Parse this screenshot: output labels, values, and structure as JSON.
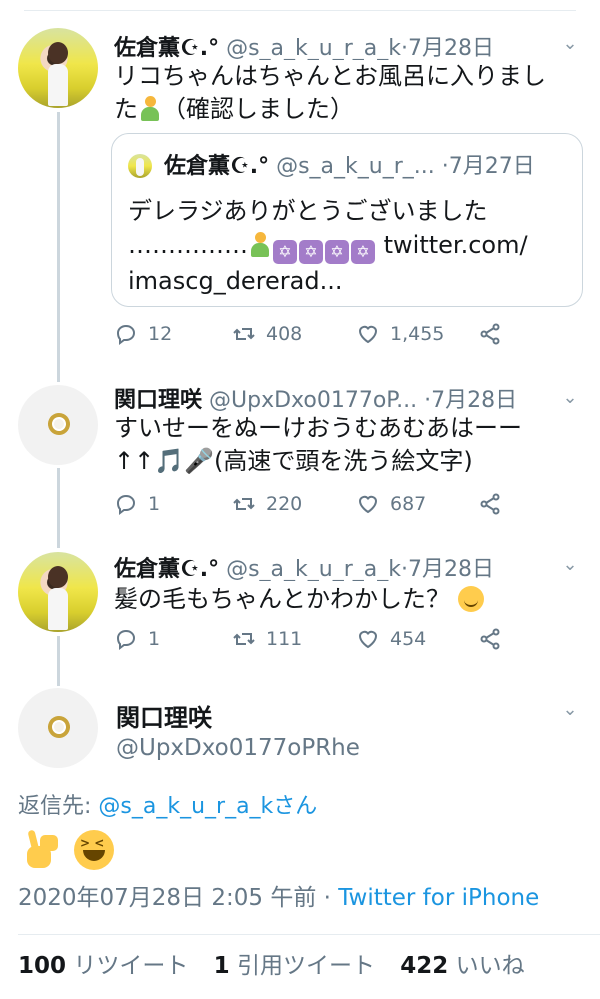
{
  "tweets": [
    {
      "name": "佐倉薫☪︎.°",
      "handle": "@s_a_k_u_r_a_k",
      "dot": "·",
      "date": "7月28日",
      "text_line1": "リコちゃんはちゃんとお風呂に入りまし",
      "text_line2_pre": "た",
      "text_line2_post": "（確認しました）",
      "quote": {
        "name": "佐倉薫☪︎.°",
        "handle": "@s_a_k_u_r_...",
        "dot": "·",
        "date": "7月27日",
        "line1": "デレラジありがとうございました",
        "line2_pre": "……………",
        "emoji_star": "✡",
        "line2_link": "twitter.com/",
        "line3_link": "imascg_dererad..."
      },
      "replies": "12",
      "retweets": "408",
      "likes": "1,455"
    },
    {
      "name": "関口理咲",
      "handle": "@UpxDxo0177oP...",
      "dot": "·",
      "date": "7月28日",
      "text_line1": "すいせーをぬーけおうむあむあはーー",
      "text_line2": "↑↑🎵🎤(高速で頭を洗う絵文字)",
      "replies": "1",
      "retweets": "220",
      "likes": "687"
    },
    {
      "name": "佐倉薫☪︎.°",
      "handle": "@s_a_k_u_r_a_k",
      "dot": "·",
      "date": "7月28日",
      "text_line1": "髪の毛もちゃんとかわかした？",
      "replies": "1",
      "retweets": "111",
      "likes": "454"
    }
  ],
  "main": {
    "name": "関口理咲",
    "handle": "@UpxDxo0177oPRhe",
    "reply_prefix": "返信先: ",
    "reply_target": "@s_a_k_u_r_a_kさん",
    "timestamp": "2020年07月28日 2:05 午前",
    "timestamp_dot": " · ",
    "client": "Twitter for iPhone",
    "retweet_count": "100",
    "retweet_label": "リツイート",
    "quote_count": "1",
    "quote_label": "引用ツイート",
    "like_count": "422",
    "like_label": "いいね"
  },
  "icons": [
    "reply-icon",
    "retweet-icon",
    "like-icon",
    "share-icon",
    "chevron-down-icon"
  ],
  "colors": {
    "link": "#1b95e0",
    "muted": "#657786",
    "line": "#ccd6dd"
  }
}
